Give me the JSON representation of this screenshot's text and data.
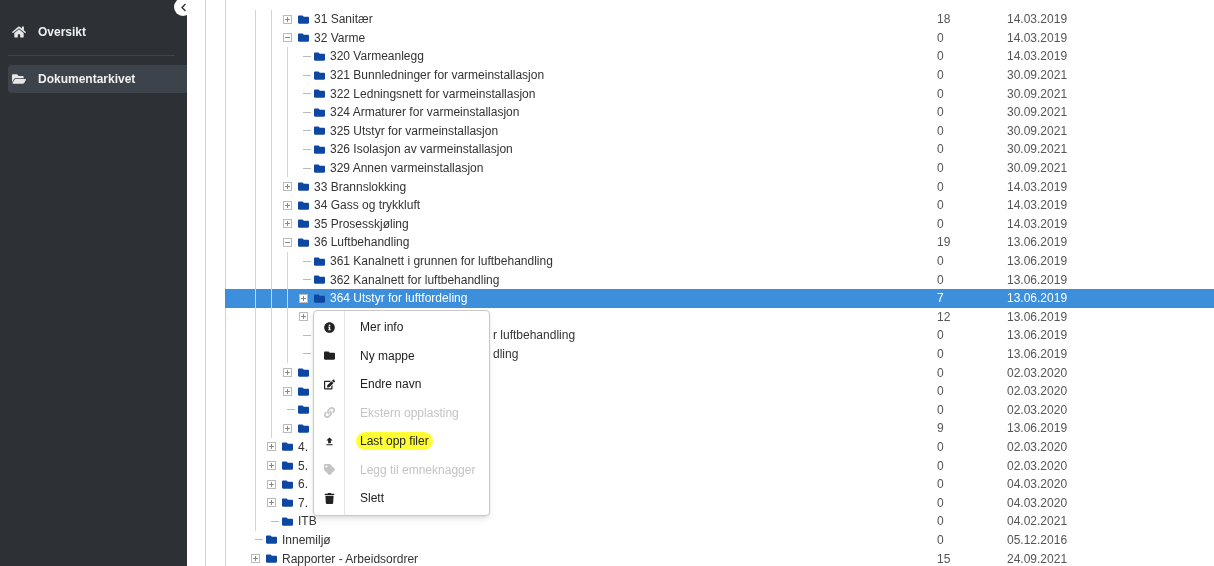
{
  "sidebar": {
    "items": [
      {
        "label": "Oversikt",
        "selected": false
      },
      {
        "label": "Dokumentarkivet",
        "selected": true
      }
    ]
  },
  "tree": [
    {
      "kind": "offscreen",
      "children": [
        {
          "kind": "offscreen",
          "children": [
            {
              "kind": "branch",
              "label": "31 Sanitær",
              "expanded": false,
              "selected": false,
              "count": "18",
              "date": "14.03.2019"
            },
            {
              "kind": "branch",
              "label": "32 Varme",
              "expanded": true,
              "selected": false,
              "count": "0",
              "date": "14.03.2019",
              "children": [
                {
                  "kind": "leaf",
                  "label": "320 Varmeanlegg",
                  "selected": false,
                  "count": "0",
                  "date": "14.03.2019"
                },
                {
                  "kind": "leaf",
                  "label": "321 Bunnledninger for varmeinstallasjon",
                  "selected": false,
                  "count": "0",
                  "date": "30.09.2021"
                },
                {
                  "kind": "leaf",
                  "label": "322 Ledningsnett for varmeinstallasjon",
                  "selected": false,
                  "count": "0",
                  "date": "30.09.2021"
                },
                {
                  "kind": "leaf",
                  "label": "324 Armaturer for varmeinstallasjon",
                  "selected": false,
                  "count": "0",
                  "date": "30.09.2021"
                },
                {
                  "kind": "leaf",
                  "label": "325 Utstyr for varmeinstallasjon",
                  "selected": false,
                  "count": "0",
                  "date": "30.09.2021"
                },
                {
                  "kind": "leaf",
                  "label": "326 Isolasjon av varmeinstallasjon",
                  "selected": false,
                  "count": "0",
                  "date": "30.09.2021"
                },
                {
                  "kind": "leaf",
                  "label": "329 Annen varmeinstallasjon",
                  "selected": false,
                  "count": "0",
                  "date": "30.09.2021"
                }
              ]
            },
            {
              "kind": "branch",
              "label": "33 Brannslokking",
              "expanded": false,
              "selected": false,
              "count": "0",
              "date": "14.03.2019"
            },
            {
              "kind": "branch",
              "label": "34 Gass og trykkluft",
              "expanded": false,
              "selected": false,
              "count": "0",
              "date": "14.03.2019"
            },
            {
              "kind": "branch",
              "label": "35 Prosesskjøling",
              "expanded": false,
              "selected": false,
              "count": "0",
              "date": "14.03.2019"
            },
            {
              "kind": "branch",
              "label": "36 Luftbehandling",
              "expanded": true,
              "selected": false,
              "count": "19",
              "date": "13.06.2019",
              "children": [
                {
                  "kind": "leaf",
                  "label": "361 Kanalnett i grunnen for luftbehandling",
                  "selected": false,
                  "count": "0",
                  "date": "13.06.2019"
                },
                {
                  "kind": "leaf",
                  "label": "362 Kanalnett for luftbehandling",
                  "selected": false,
                  "count": "0",
                  "date": "13.06.2019"
                },
                {
                  "kind": "branch",
                  "label": "364 Utstyr for luftfordeling",
                  "expanded": false,
                  "selected": true,
                  "count": "7",
                  "date": "13.06.2019"
                },
                {
                  "kind": "branch",
                  "expanded": false,
                  "selected": false,
                  "count": "12",
                  "date": "13.06.2019"
                },
                {
                  "kind": "leaf",
                  "label_tail": "r luftbehandling",
                  "selected": false,
                  "count": "0",
                  "date": "13.06.2019"
                },
                {
                  "kind": "leaf",
                  "label_tail": "dling",
                  "selected": false,
                  "count": "0",
                  "date": "13.06.2019"
                }
              ]
            },
            {
              "kind": "branch",
              "expanded": false,
              "selected": false,
              "count": "0",
              "date": "02.03.2020"
            },
            {
              "kind": "branch",
              "expanded": false,
              "selected": false,
              "count": "0",
              "date": "02.03.2020"
            },
            {
              "kind": "leaf",
              "selected": false,
              "count": "0",
              "date": "02.03.2020"
            },
            {
              "kind": "branch",
              "expanded": false,
              "selected": false,
              "count": "9",
              "date": "13.06.2019"
            }
          ]
        },
        {
          "kind": "branch",
          "label": "4.",
          "expanded": false,
          "selected": false,
          "count": "0",
          "date": "02.03.2020"
        },
        {
          "kind": "branch",
          "label": "5.",
          "expanded": false,
          "selected": false,
          "count": "0",
          "date": "02.03.2020"
        },
        {
          "kind": "branch",
          "label": "6.",
          "expanded": false,
          "selected": false,
          "count": "0",
          "date": "04.03.2020"
        },
        {
          "kind": "branch",
          "label": "7.",
          "expanded": false,
          "selected": false,
          "count": "0",
          "date": "04.03.2020"
        },
        {
          "kind": "leaf",
          "label": "ITB",
          "selected": false,
          "count": "0",
          "date": "04.02.2021"
        }
      ]
    },
    {
      "kind": "leaf",
      "label": "Innemiljø",
      "selected": false,
      "count": "0",
      "date": "05.12.2016"
    },
    {
      "kind": "branch",
      "label": "Rapporter - Arbeidsordrer",
      "expanded": false,
      "selected": false,
      "count": "15",
      "date": "24.09.2021"
    }
  ],
  "context_menu": [
    {
      "label": "Mer info",
      "disabled": false,
      "highlighted": false
    },
    {
      "label": "Ny mappe",
      "disabled": false,
      "highlighted": false
    },
    {
      "label": "Endre navn",
      "disabled": false,
      "highlighted": false
    },
    {
      "label": "Ekstern opplasting",
      "disabled": true,
      "highlighted": false
    },
    {
      "label": "Last opp filer",
      "disabled": false,
      "highlighted": true
    },
    {
      "label": "Legg til emneknagger",
      "disabled": true,
      "highlighted": false
    },
    {
      "label": "Slett",
      "disabled": false,
      "highlighted": false
    }
  ]
}
